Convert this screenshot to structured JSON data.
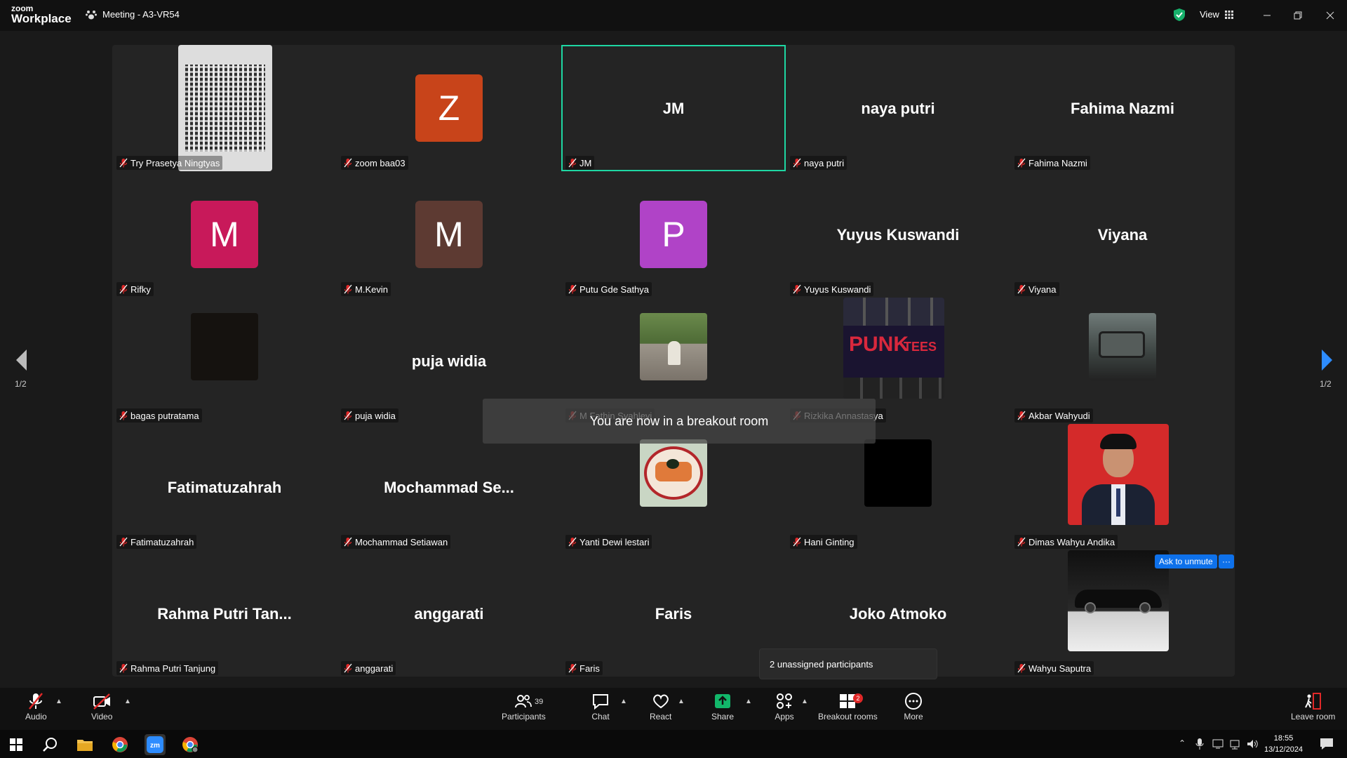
{
  "titlebar": {
    "logo_top": "zoom",
    "logo_bottom": "Workplace",
    "meeting_title": "Meeting - A3-VR54",
    "view_label": "View"
  },
  "tiles": [
    {
      "name": "Try Prasetya Ningtyas",
      "display": "photo",
      "photo": "qr-document"
    },
    {
      "name": "zoom baa03",
      "display": "avatar",
      "letter": "Z",
      "color": "#c8441a"
    },
    {
      "name": "JM",
      "display": "text",
      "text": "JM",
      "active": true
    },
    {
      "name": "naya putri",
      "display": "text",
      "text": "naya putri"
    },
    {
      "name": "Fahima Nazmi",
      "display": "text",
      "text": "Fahima Nazmi"
    },
    {
      "name": "Rifky",
      "display": "avatar",
      "letter": "M",
      "color": "#c8195a"
    },
    {
      "name": "M.Kevin",
      "display": "avatar",
      "letter": "M",
      "color": "#5d3a32"
    },
    {
      "name": "Putu Gde Sathya",
      "display": "avatar",
      "letter": "P",
      "color": "#b043c7"
    },
    {
      "name": "Yuyus Kuswandi",
      "display": "text",
      "text": "Yuyus Kuswandi"
    },
    {
      "name": "Viyana",
      "display": "text",
      "text": "Viyana"
    },
    {
      "name": "bagas putratama",
      "display": "photo",
      "photo": "dark-square"
    },
    {
      "name": "puja widia",
      "display": "text",
      "text": "puja widia"
    },
    {
      "name": "M Fathin Syahleyi",
      "display": "photo",
      "photo": "street-scene"
    },
    {
      "name": "Rizkika Annastasya",
      "display": "photo",
      "photo": "punk-tees"
    },
    {
      "name": "Akbar Wahyudi",
      "display": "photo",
      "photo": "car-interior"
    },
    {
      "name": "Fatimatuzahrah",
      "display": "text",
      "text": "Fatimatuzahrah"
    },
    {
      "name": "Mochammad Setiawan",
      "display": "text",
      "text": "Mochammad  Se..."
    },
    {
      "name": "Yanti Dewi lestari",
      "display": "photo",
      "photo": "food-plate"
    },
    {
      "name": "Hani Ginting",
      "display": "photo",
      "photo": "black-square"
    },
    {
      "name": "Dimas Wahyu Andika",
      "display": "photo",
      "photo": "portrait-red"
    },
    {
      "name": "Rahma Putri Tanjung",
      "display": "text",
      "text": "Rahma  Putri  Tan..."
    },
    {
      "name": "anggarati",
      "display": "text",
      "text": "anggarati"
    },
    {
      "name": "Faris",
      "display": "text",
      "text": "Faris"
    },
    {
      "name": "Joko Atmoko",
      "display": "text",
      "text": "Joko Atmoko"
    },
    {
      "name": "Wahyu Saputra",
      "display": "photo",
      "photo": "car-dark"
    }
  ],
  "pagination": {
    "left": "1/2",
    "right": "1/2"
  },
  "toast": "You are now in a breakout room",
  "unassigned": "2 unassigned participants",
  "ask_unmute": "Ask to unmute",
  "more_dots": "···",
  "toolbar": {
    "audio": "Audio",
    "video": "Video",
    "participants": "Participants",
    "participants_count": "39",
    "chat": "Chat",
    "react": "React",
    "share": "Share",
    "apps": "Apps",
    "breakout": "Breakout rooms",
    "breakout_badge": "2",
    "more": "More",
    "leave": "Leave room"
  },
  "taskbar": {
    "time": "18:55",
    "date": "13/12/2024"
  },
  "colors": {
    "active_border": "#1ed7a3",
    "share_green": "#12b76a",
    "accent_blue": "#0e71eb",
    "muted_red": "#e02828"
  }
}
